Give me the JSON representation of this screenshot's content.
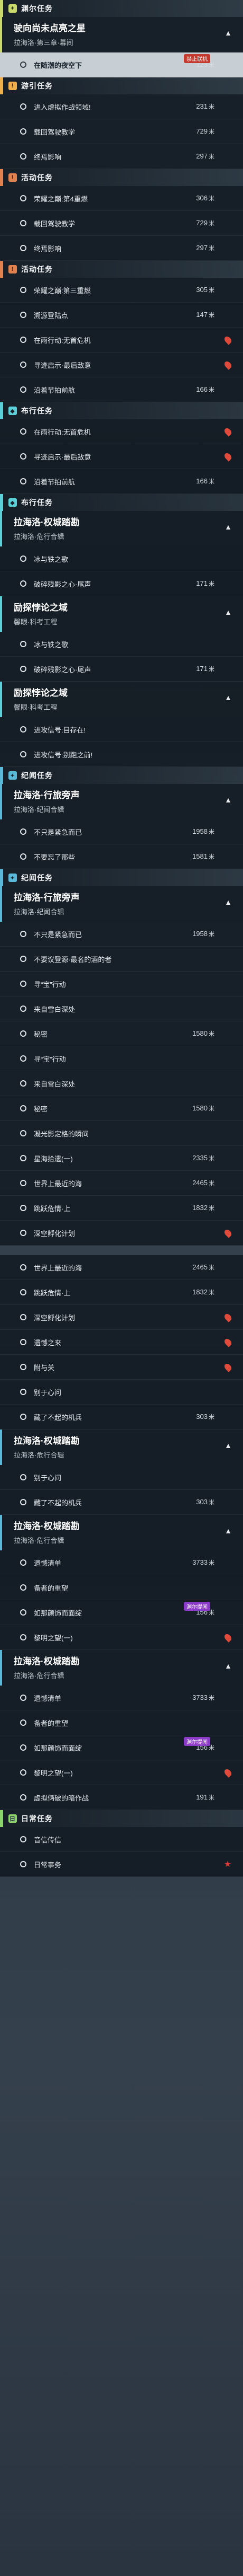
{
  "accents": {
    "abyss": "#c9d86a",
    "story": "#f0b04a",
    "event": "#e1824e",
    "main": "#5cd0d8",
    "side": "#5ab8d8",
    "daily": "#8bd36b",
    "tag_purple": "#8a3cc8",
    "pin_red": "#e04a3a"
  },
  "sections": [
    {
      "type": "header",
      "key": "abyss",
      "icon": "+",
      "title": "渊尔任务"
    },
    {
      "type": "card",
      "key": "abyss",
      "title": "驶向尚未点亮之星",
      "subtitle": "拉海洛·第三章·幕间"
    },
    {
      "type": "row",
      "style": "sel",
      "label": "在随潮的夜空下",
      "distance": "123",
      "unit": "米",
      "tag": "禁止联机",
      "tagColor": "red"
    },
    {
      "type": "header",
      "key": "story",
      "icon": "!",
      "title": "游引任务"
    },
    {
      "type": "row",
      "label": "进入虚拟作战领域!",
      "distance": "231",
      "unit": "米"
    },
    {
      "type": "row",
      "label": "载回驾驶教学",
      "distance": "729",
      "unit": "米"
    },
    {
      "type": "row",
      "label": "终焉影响",
      "distance": "297",
      "unit": "米"
    },
    {
      "type": "header",
      "key": "event",
      "icon": "!",
      "title": "活动任务"
    },
    {
      "type": "row",
      "label": "荣耀之巅:第4重燃",
      "distance": "306",
      "unit": "米"
    },
    {
      "type": "row",
      "label": "载回驾驶教学",
      "distance": "729",
      "unit": "米"
    },
    {
      "type": "row",
      "label": "终焉影响",
      "distance": "297",
      "unit": "米"
    },
    {
      "type": "header",
      "key": "event",
      "icon": "!",
      "title": "活动任务"
    },
    {
      "type": "row",
      "label": "荣耀之巅:第三重燃",
      "distance": "305",
      "unit": "米"
    },
    {
      "type": "row",
      "label": "溯源登陆点",
      "distance": "147",
      "unit": "米"
    },
    {
      "type": "row",
      "label": "在雨行动:无首危机",
      "icon": "pin"
    },
    {
      "type": "row",
      "label": "寻迹启示·最后敌意",
      "icon": "pin"
    },
    {
      "type": "row",
      "label": "沿着节拍前航",
      "distance": "166",
      "unit": "米"
    },
    {
      "type": "header",
      "key": "main",
      "icon": "◆",
      "title": "布行任务"
    },
    {
      "type": "row",
      "label": "在雨行动:无首危机",
      "icon": "pin"
    },
    {
      "type": "row",
      "label": "寻迹启示·最后敌意",
      "icon": "pin"
    },
    {
      "type": "row",
      "label": "沿着节拍前航",
      "distance": "166",
      "unit": "米"
    },
    {
      "type": "header",
      "key": "main",
      "icon": "◆",
      "title": "布行任务"
    },
    {
      "type": "card",
      "key": "main",
      "title": "拉海洛·权城踏勘",
      "subtitle": "拉海洛·危行合辑"
    },
    {
      "type": "row",
      "label": "冰与铁之歌"
    },
    {
      "type": "row",
      "label": "破碎残影之心·尾声",
      "distance": "171",
      "unit": "米"
    },
    {
      "type": "card",
      "key": "main",
      "title": "励探悖论之域",
      "subtitle": "馨眼·科考工程"
    },
    {
      "type": "row",
      "label": "冰与铁之歌"
    },
    {
      "type": "row",
      "label": "破碎残影之心·尾声",
      "distance": "171",
      "unit": "米"
    },
    {
      "type": "card",
      "key": "main",
      "title": "励探悖论之域",
      "subtitle": "馨眼·科考工程"
    },
    {
      "type": "row",
      "label": "进攻信号:目存在!"
    },
    {
      "type": "row",
      "label": "进攻信号:别跑之前!"
    },
    {
      "type": "header",
      "key": "side",
      "icon": "✦",
      "title": "纪闻任务"
    },
    {
      "type": "card",
      "key": "side",
      "title": "拉海洛·行旅旁声",
      "subtitle": "拉海洛·纪闻合辑"
    },
    {
      "type": "row",
      "label": "不只是紧急而已",
      "distance": "1958",
      "unit": "米"
    },
    {
      "type": "row",
      "label": "不要忘了那些",
      "distance": "1581",
      "unit": "米"
    },
    {
      "type": "header",
      "key": "side",
      "icon": "✦",
      "title": "纪闻任务"
    },
    {
      "type": "card",
      "key": "side",
      "title": "拉海洛·行旅旁声",
      "subtitle": "拉海洛·纪闻合辑"
    },
    {
      "type": "row",
      "label": "不只是紧急而已",
      "distance": "1958",
      "unit": "米"
    },
    {
      "type": "row",
      "label": "不要议登源·最名的酒的者"
    },
    {
      "type": "row",
      "label": "寻“宝”行动"
    },
    {
      "type": "row",
      "label": "来自雪白深处"
    },
    {
      "type": "row",
      "label": "秘密",
      "distance": "1580",
      "unit": "米"
    },
    {
      "type": "row",
      "label": "寻“宝”行动"
    },
    {
      "type": "row",
      "label": "来自雪白深处"
    },
    {
      "type": "row",
      "label": "秘密",
      "distance": "1580",
      "unit": "米"
    },
    {
      "type": "row",
      "label": "凝光影定格的瞬间"
    },
    {
      "type": "row",
      "label": "星海拾遗(一)",
      "distance": "2335",
      "unit": "米"
    },
    {
      "type": "row",
      "label": "世界上最近的海",
      "distance": "2465",
      "unit": "米"
    },
    {
      "type": "row",
      "label": "跳跃危情·上",
      "distance": "1832",
      "unit": "米"
    },
    {
      "type": "row",
      "label": "深空孵化计划",
      "icon": "pin"
    },
    {
      "type": "spacer"
    },
    {
      "type": "row",
      "label": "世界上最近的海",
      "distance": "2465",
      "unit": "米"
    },
    {
      "type": "row",
      "label": "跳跃危情·上",
      "distance": "1832",
      "unit": "米"
    },
    {
      "type": "row",
      "label": "深空孵化计划",
      "icon": "pin"
    },
    {
      "type": "row",
      "label": "遗憾之来",
      "icon": "pin"
    },
    {
      "type": "row",
      "label": "附与关",
      "icon": "pin"
    },
    {
      "type": "row",
      "label": "别于心问"
    },
    {
      "type": "row",
      "label": "藏了不起的机兵",
      "distance": "303",
      "unit": "米"
    },
    {
      "type": "card",
      "key": "side",
      "title": "拉海洛·权城踏勘",
      "subtitle": "拉海洛·危行合辑"
    },
    {
      "type": "row",
      "label": "别于心问"
    },
    {
      "type": "row",
      "label": "藏了不起的机兵",
      "distance": "303",
      "unit": "米"
    },
    {
      "type": "card",
      "key": "side",
      "title": "拉海洛·权城踏勘",
      "subtitle": "拉海洛·危行合辑"
    },
    {
      "type": "row",
      "label": "遗憾清单",
      "distance": "3733",
      "unit": "米"
    },
    {
      "type": "row",
      "label": "备者的重望"
    },
    {
      "type": "row",
      "label": "如那颜饰而面绽",
      "distance": "156",
      "unit": "米",
      "tag": "渊尔提闻",
      "tagColor": "purple"
    },
    {
      "type": "row",
      "label": "黎明之望(一)",
      "icon": "pin"
    },
    {
      "type": "card",
      "key": "side",
      "title": "拉海洛·权城踏勘",
      "subtitle": "拉海洛·危行合辑"
    },
    {
      "type": "row",
      "label": "遗憾清单",
      "distance": "3733",
      "unit": "米"
    },
    {
      "type": "row",
      "label": "备者的重望"
    },
    {
      "type": "row",
      "label": "如那颜饰而面绽",
      "distance": "156",
      "unit": "米",
      "tag": "渊尔提闻",
      "tagColor": "purple"
    },
    {
      "type": "row",
      "label": "黎明之望(一)",
      "icon": "pin"
    },
    {
      "type": "row",
      "label": "虚拟俩破的暗作战",
      "distance": "191",
      "unit": "米"
    },
    {
      "type": "header",
      "key": "daily",
      "icon": "日",
      "title": "日常任务"
    },
    {
      "type": "row",
      "label": "音信传信"
    },
    {
      "type": "row",
      "label": "日常事务",
      "icon": "star"
    }
  ]
}
